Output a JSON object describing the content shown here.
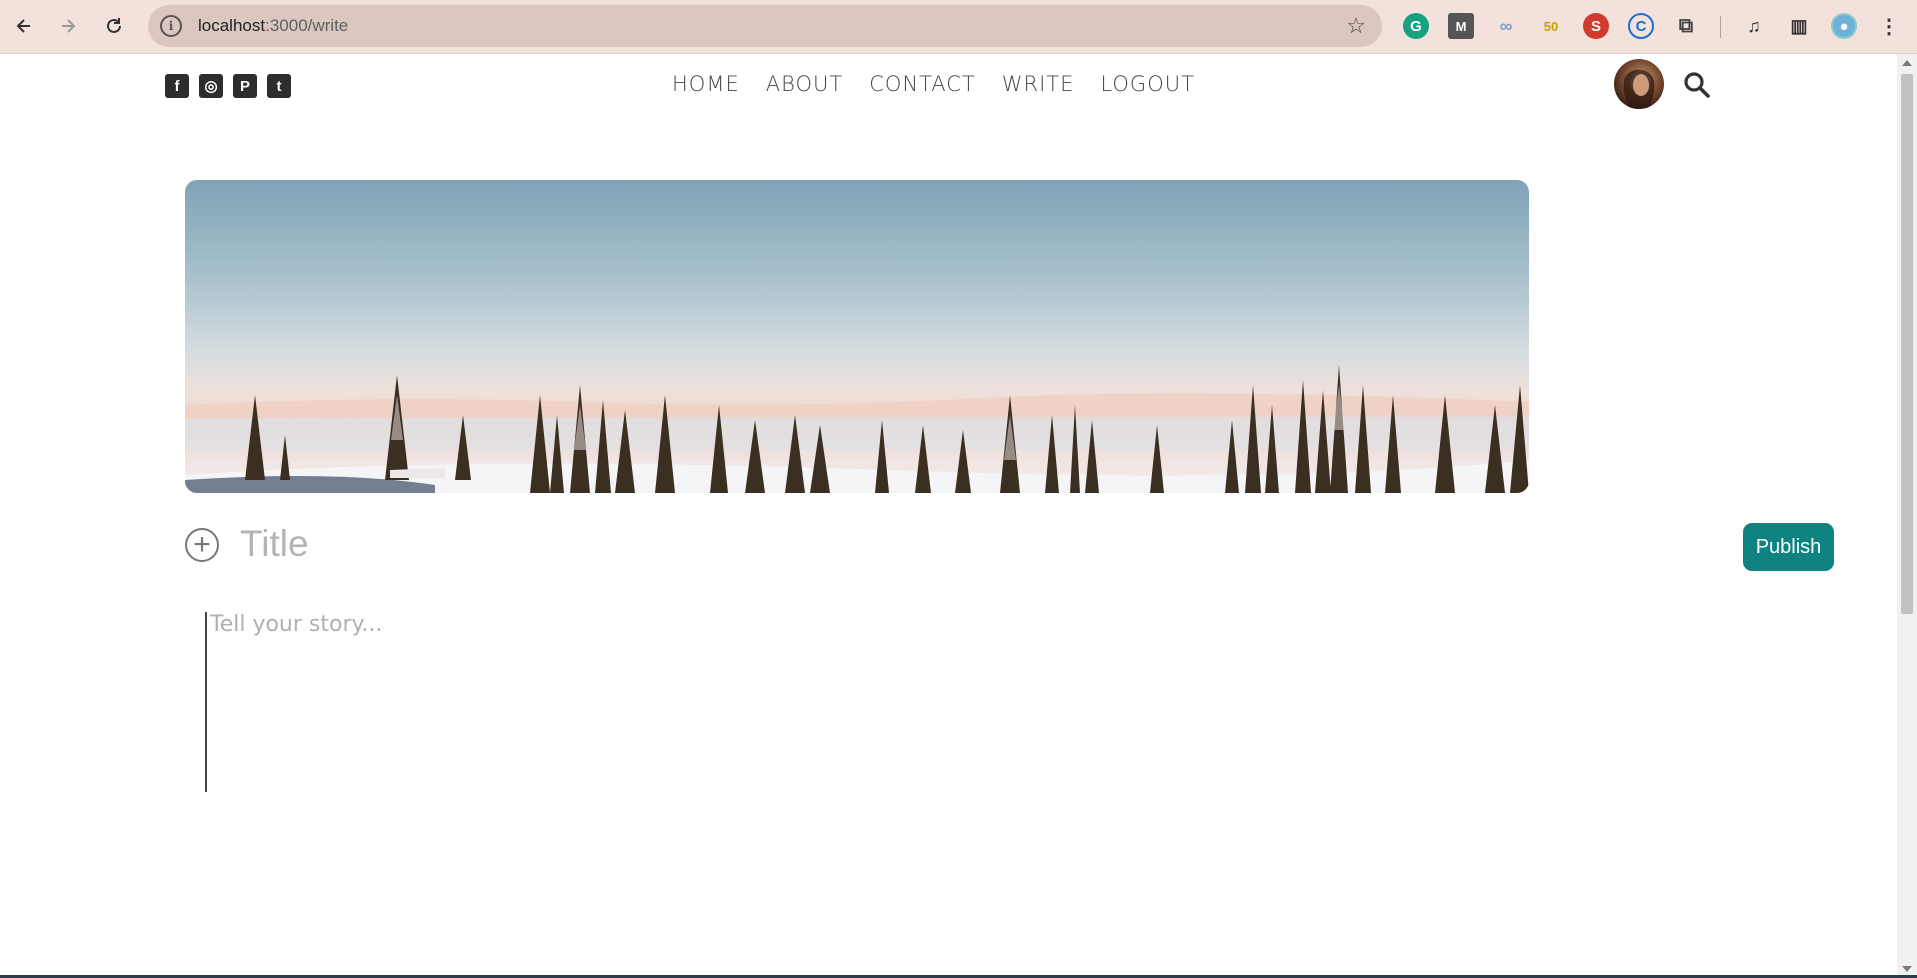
{
  "browser": {
    "url_host": "localhost",
    "url_path": ":3000/write",
    "info_icon": "info-icon",
    "star_icon": "star-icon"
  },
  "header": {
    "social": [
      {
        "icon": "facebook-icon",
        "glyph": "f"
      },
      {
        "icon": "instagram-icon",
        "glyph": "◎"
      },
      {
        "icon": "pinterest-icon",
        "glyph": "P"
      },
      {
        "icon": "twitter-icon",
        "glyph": "t"
      }
    ],
    "menu": [
      "HOME",
      "ABOUT",
      "CONTACT",
      "WRITE",
      "LOGOUT"
    ]
  },
  "write": {
    "title_placeholder": "Title",
    "story_placeholder": "Tell your story...",
    "publish_label": "Publish",
    "add_glyph": "+"
  },
  "colors": {
    "publish_bg": "#0f8282",
    "chrome_bg": "#f3e1dc"
  }
}
